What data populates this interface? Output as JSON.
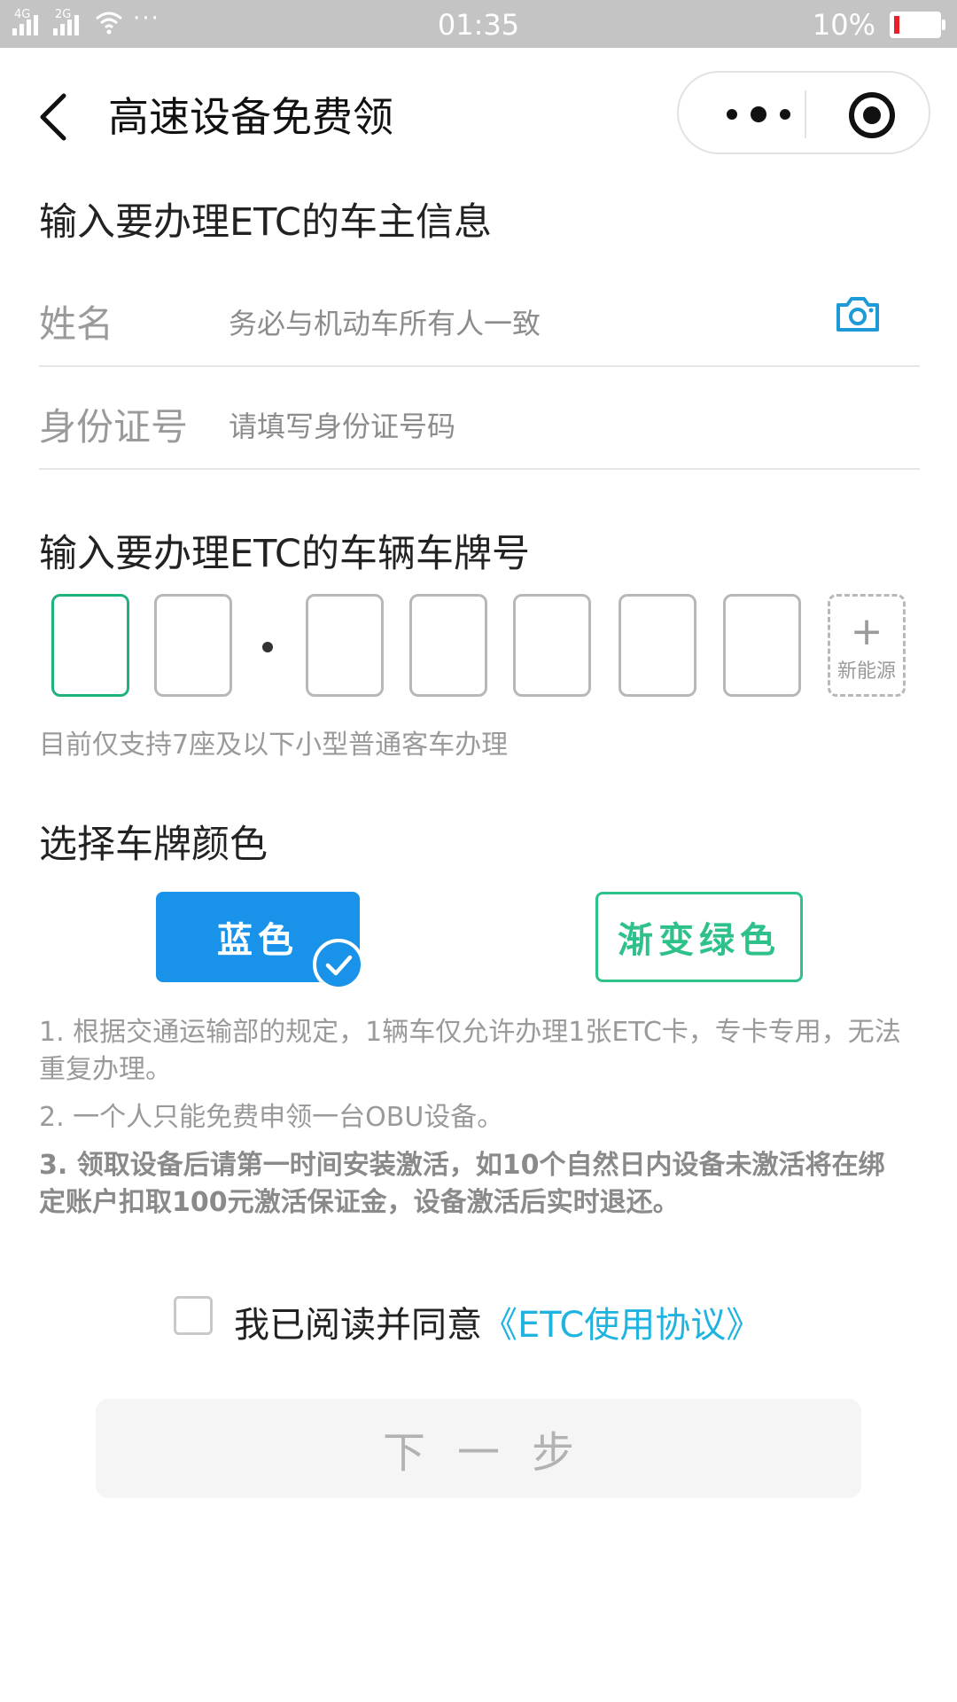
{
  "status_bar": {
    "network_1": "4G",
    "network_2": "2G",
    "time": "01:35",
    "battery_percent": "10%",
    "battery_level": 0.1,
    "dots": "···"
  },
  "nav": {
    "title": "高速设备免费领",
    "back_icon": "chevron-left-icon",
    "more_icon": "more-dots-icon",
    "close_icon": "target-circle-icon"
  },
  "owner_section": {
    "title": "输入要办理ETC的车主信息",
    "name_field": {
      "label": "姓名",
      "placeholder": "务必与机动车所有人一致",
      "icon": "camera-icon"
    },
    "id_field": {
      "label": "身份证号",
      "placeholder": "请填写身份证号码"
    }
  },
  "plate_section": {
    "title": "输入要办理ETC的车辆车牌号",
    "new_energy_plus": "+",
    "new_energy_label": "新能源",
    "hint": "目前仅支持7座及以下小型普通客车办理"
  },
  "color_section": {
    "title": "选择车牌颜色",
    "options": [
      {
        "label": "蓝色",
        "selected": true,
        "color": "#1993ea"
      },
      {
        "label": "渐变绿色",
        "selected": false,
        "color": "#2fc18a"
      }
    ]
  },
  "notes": [
    "1. 根据交通运输部的规定，1辆车仅允许办理1张ETC卡，专卡专用，无法重复办理。",
    "2.  一个人只能免费申领一台OBU设备。",
    "3. 领取设备后请第一时间安装激活，如10个自然日内设备未激活将在绑定账户扣取100元激活保证金，设备激活后实时退还。"
  ],
  "agreement": {
    "checked": false,
    "text": "我已阅读并同意",
    "link": "《ETC使用协议》",
    "link_color": "#1fb4e0"
  },
  "next_button": {
    "label": "下一步"
  },
  "colors": {
    "status_bar_bg": "#c4c4c4",
    "accent_green": "#1fb27a",
    "accent_blue": "#1993ea"
  }
}
